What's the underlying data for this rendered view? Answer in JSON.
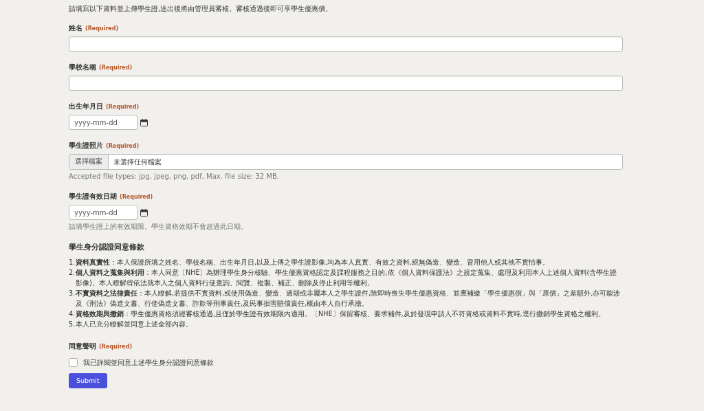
{
  "intro": "請填寫以下資料並上傳學生證,送出後將由管理員審核。審核通過後即可享學生優惠價。",
  "fields": [
    {
      "kind": "text",
      "label": "姓名",
      "required": "(Required)"
    },
    {
      "kind": "text",
      "label": "學校名稱",
      "required": "(Required)"
    },
    {
      "kind": "date",
      "label": "出生年月日",
      "required": "(Required)",
      "placeholder": "yyyy-mm-dd"
    },
    {
      "kind": "file",
      "label": "學生證照片",
      "required": "(Required)",
      "button": "選擇檔案",
      "status": "未選擇任何檔案",
      "hint": "Accepted file types: jpg, jpeg, png, pdf, Max. file size: 32 MB."
    },
    {
      "kind": "date",
      "label": "學生證有效日期",
      "required": "(Required)",
      "placeholder": "yyyy-mm-dd",
      "hint": "請填學生證上的有效期限。學生資格效期不會超過此日期。"
    }
  ],
  "terms": {
    "title": "學生身分認證同意條款",
    "items": [
      {
        "number": "1.",
        "text": "**資料真實性**：本人保證所填之姓名、學校名稱、出生年月日,以及上傳之學生證影像,均為本人真實、有效之資料,絕無偽造、變造、冒用他人或其他不實情事。"
      },
      {
        "number": "2.",
        "text": "**個人資料之蒐集與利用**：本人同意〔NHE〕為辦理學生身分核驗、學生優惠資格認定及課程服務之目的,依《個人資料保護法》之規定蒐集、處理及利用本人上述個人資料(含學生證影像)。本人瞭解得依法就本人之個人資料行使查詢、閱覽、複製、補正、刪除及停止利用等權利。"
      },
      {
        "number": "3.",
        "text": "**不實資料之法律責任**：本人瞭解,若提供不實資料,或使用偽造、變造、過期或非屬本人之學生證件,除即時喪失學生優惠資格、並應補繳「學生優惠價」與「原價」之差額外,亦可能涉及《刑法》偽造文書、行使偽造文書、詐欺等刑事責任,及民事損害賠償責任,概由本人自行承擔。"
      },
      {
        "number": "4.",
        "text": "**資格效期與撤銷**：學生優惠資格須經審核通過,且僅於學生證有效期限內適用。〔NHE〕保留審核、要求補件,及於發現申請人不符資格或資料不實時,逕行撤銷學生資格之權利。"
      },
      {
        "number": "5.",
        "text": "本人已充分瞭解並同意上述全部內容。"
      }
    ]
  },
  "consent": {
    "label": "同意聲明",
    "required": "(Required)",
    "checkbox_label": "我已詳閱並同意上述學生身分認證同意條款",
    "checked": false
  },
  "submit": "Submit"
}
